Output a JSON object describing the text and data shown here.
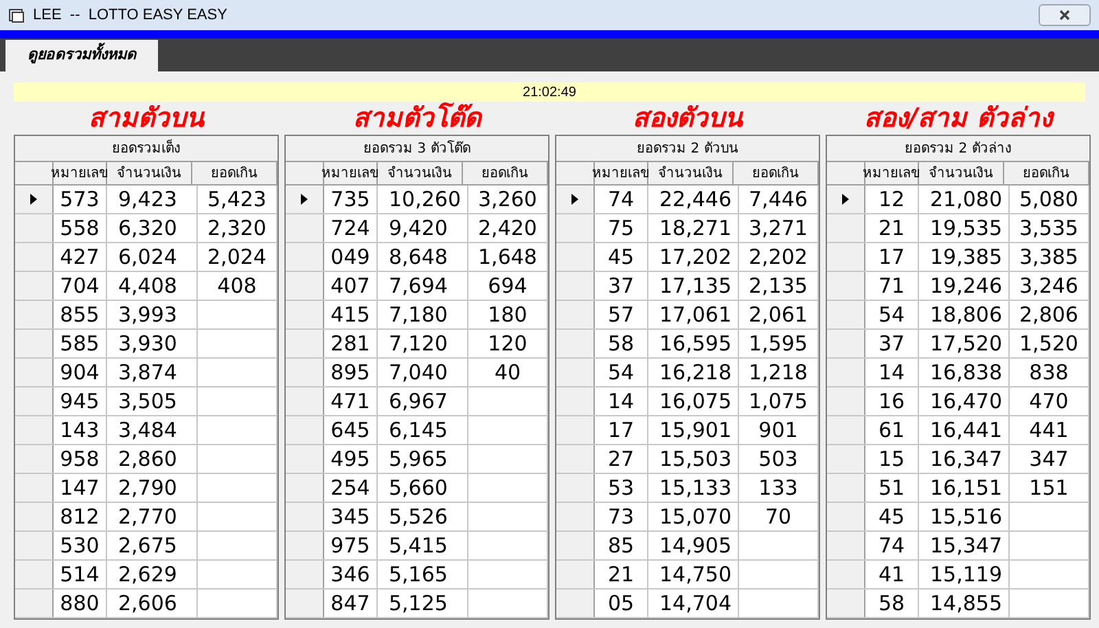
{
  "window": {
    "title": "LEE  --  LOTTO EASY EASY"
  },
  "tabs": [
    {
      "label": "ดูยอดรวมทั้งหมด",
      "selected": true
    }
  ],
  "status": {
    "time": "21:02:49"
  },
  "panels": [
    {
      "heading": "สามตัวบน",
      "subheading": "ยอดรวมเต็ง",
      "columns": [
        "หมายเลข",
        "จำนวนเงิน",
        "ยอดเกิน"
      ],
      "rows": [
        {
          "selected": true,
          "cells": [
            "573",
            "9,423",
            "5,423"
          ]
        },
        {
          "selected": false,
          "cells": [
            "558",
            "6,320",
            "2,320"
          ]
        },
        {
          "selected": false,
          "cells": [
            "427",
            "6,024",
            "2,024"
          ]
        },
        {
          "selected": false,
          "cells": [
            "704",
            "4,408",
            "408"
          ]
        },
        {
          "selected": false,
          "cells": [
            "855",
            "3,993"
          ]
        },
        {
          "selected": false,
          "cells": [
            "585",
            "3,930"
          ]
        },
        {
          "selected": false,
          "cells": [
            "904",
            "3,874"
          ]
        },
        {
          "selected": false,
          "cells": [
            "945",
            "3,505"
          ]
        },
        {
          "selected": false,
          "cells": [
            "143",
            "3,484"
          ]
        },
        {
          "selected": false,
          "cells": [
            "958",
            "2,860"
          ]
        },
        {
          "selected": false,
          "cells": [
            "147",
            "2,790"
          ]
        },
        {
          "selected": false,
          "cells": [
            "812",
            "2,770"
          ]
        },
        {
          "selected": false,
          "cells": [
            "530",
            "2,675"
          ]
        },
        {
          "selected": false,
          "cells": [
            "514",
            "2,629"
          ]
        },
        {
          "selected": false,
          "cells": [
            "880",
            "2,606"
          ]
        }
      ]
    },
    {
      "heading": "สามตัวโต๊ด",
      "subheading": "ยอดรวม 3 ตัวโต๊ด",
      "columns": [
        "หมายเลข",
        "จำนวนเงิน",
        "ยอดเกิน"
      ],
      "rows": [
        {
          "selected": true,
          "cells": [
            "735",
            "10,260",
            "3,260"
          ]
        },
        {
          "selected": false,
          "cells": [
            "724",
            "9,420",
            "2,420"
          ]
        },
        {
          "selected": false,
          "cells": [
            "049",
            "8,648",
            "1,648"
          ]
        },
        {
          "selected": false,
          "cells": [
            "407",
            "7,694",
            "694"
          ]
        },
        {
          "selected": false,
          "cells": [
            "415",
            "7,180",
            "180"
          ]
        },
        {
          "selected": false,
          "cells": [
            "281",
            "7,120",
            "120"
          ]
        },
        {
          "selected": false,
          "cells": [
            "895",
            "7,040",
            "40"
          ]
        },
        {
          "selected": false,
          "cells": [
            "471",
            "6,967"
          ]
        },
        {
          "selected": false,
          "cells": [
            "645",
            "6,145"
          ]
        },
        {
          "selected": false,
          "cells": [
            "495",
            "5,965"
          ]
        },
        {
          "selected": false,
          "cells": [
            "254",
            "5,660"
          ]
        },
        {
          "selected": false,
          "cells": [
            "345",
            "5,526"
          ]
        },
        {
          "selected": false,
          "cells": [
            "975",
            "5,415"
          ]
        },
        {
          "selected": false,
          "cells": [
            "346",
            "5,165"
          ]
        },
        {
          "selected": false,
          "cells": [
            "847",
            "5,125"
          ]
        }
      ]
    },
    {
      "heading": "สองตัวบน",
      "subheading": "ยอดรวม 2 ตัวบน",
      "columns": [
        "หมายเลข",
        "จำนวนเงิน",
        "ยอดเกิน"
      ],
      "rows": [
        {
          "selected": true,
          "cells": [
            "74",
            "22,446",
            "7,446"
          ]
        },
        {
          "selected": false,
          "cells": [
            "75",
            "18,271",
            "3,271"
          ]
        },
        {
          "selected": false,
          "cells": [
            "45",
            "17,202",
            "2,202"
          ]
        },
        {
          "selected": false,
          "cells": [
            "37",
            "17,135",
            "2,135"
          ]
        },
        {
          "selected": false,
          "cells": [
            "57",
            "17,061",
            "2,061"
          ]
        },
        {
          "selected": false,
          "cells": [
            "58",
            "16,595",
            "1,595"
          ]
        },
        {
          "selected": false,
          "cells": [
            "54",
            "16,218",
            "1,218"
          ]
        },
        {
          "selected": false,
          "cells": [
            "14",
            "16,075",
            "1,075"
          ]
        },
        {
          "selected": false,
          "cells": [
            "17",
            "15,901",
            "901"
          ]
        },
        {
          "selected": false,
          "cells": [
            "27",
            "15,503",
            "503"
          ]
        },
        {
          "selected": false,
          "cells": [
            "53",
            "15,133",
            "133"
          ]
        },
        {
          "selected": false,
          "cells": [
            "73",
            "15,070",
            "70"
          ]
        },
        {
          "selected": false,
          "cells": [
            "85",
            "14,905"
          ]
        },
        {
          "selected": false,
          "cells": [
            "21",
            "14,750"
          ]
        },
        {
          "selected": false,
          "cells": [
            "05",
            "14,704"
          ]
        }
      ]
    },
    {
      "heading": "สอง/สาม ตัวล่าง",
      "subheading": "ยอดรวม 2 ตัวล่าง",
      "columns": [
        "หมายเลข",
        "จำนวนเงิน",
        "ยอดเกิน"
      ],
      "rows": [
        {
          "selected": true,
          "cells": [
            "12",
            "21,080",
            "5,080"
          ]
        },
        {
          "selected": false,
          "cells": [
            "21",
            "19,535",
            "3,535"
          ]
        },
        {
          "selected": false,
          "cells": [
            "17",
            "19,385",
            "3,385"
          ]
        },
        {
          "selected": false,
          "cells": [
            "71",
            "19,246",
            "3,246"
          ]
        },
        {
          "selected": false,
          "cells": [
            "54",
            "18,806",
            "2,806"
          ]
        },
        {
          "selected": false,
          "cells": [
            "37",
            "17,520",
            "1,520"
          ]
        },
        {
          "selected": false,
          "cells": [
            "14",
            "16,838",
            "838"
          ]
        },
        {
          "selected": false,
          "cells": [
            "16",
            "16,470",
            "470"
          ]
        },
        {
          "selected": false,
          "cells": [
            "61",
            "16,441",
            "441"
          ]
        },
        {
          "selected": false,
          "cells": [
            "15",
            "16,347",
            "347"
          ]
        },
        {
          "selected": false,
          "cells": [
            "51",
            "16,151",
            "151"
          ]
        },
        {
          "selected": false,
          "cells": [
            "45",
            "15,516"
          ]
        },
        {
          "selected": false,
          "cells": [
            "74",
            "15,347"
          ]
        },
        {
          "selected": false,
          "cells": [
            "41",
            "15,119"
          ]
        },
        {
          "selected": false,
          "cells": [
            "58",
            "14,855"
          ]
        }
      ]
    }
  ]
}
